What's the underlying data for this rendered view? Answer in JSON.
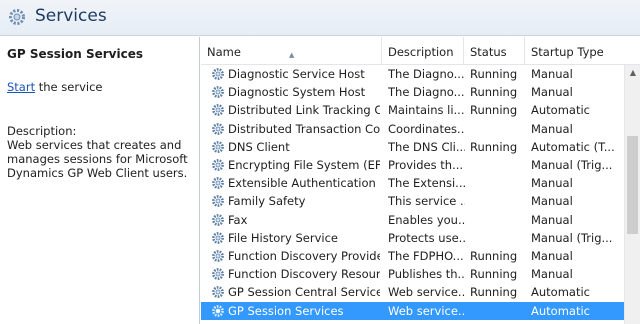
{
  "window": {
    "title": "Services",
    "icon": "services-gear-icon"
  },
  "left_pane": {
    "title": "GP Session Services",
    "action_link": "Start",
    "action_rest": " the service",
    "description_label": "Description:",
    "description_text": "Web services that creates and manages sessions for Microsoft Dynamics GP Web Client users."
  },
  "table": {
    "columns": [
      "Name",
      "Description",
      "Status",
      "Startup Type"
    ],
    "sorted_column": "Name",
    "rows": [
      {
        "name": "Diagnostic Service Host",
        "description": "The Diagno...",
        "status": "Running",
        "startup": "Manual",
        "selected": false
      },
      {
        "name": "Diagnostic System Host",
        "description": "The Diagno...",
        "status": "Running",
        "startup": "Manual",
        "selected": false
      },
      {
        "name": "Distributed Link Tracking Cl...",
        "description": "Maintains li...",
        "status": "Running",
        "startup": "Automatic",
        "selected": false
      },
      {
        "name": "Distributed Transaction Co...",
        "description": "Coordinates...",
        "status": "",
        "startup": "Manual",
        "selected": false
      },
      {
        "name": "DNS Client",
        "description": "The DNS Cli...",
        "status": "Running",
        "startup": "Automatic (T...",
        "selected": false
      },
      {
        "name": "Encrypting File System (EFS)",
        "description": "Provides th...",
        "status": "",
        "startup": "Manual (Trig...",
        "selected": false
      },
      {
        "name": "Extensible Authentication P...",
        "description": "The Extensi...",
        "status": "",
        "startup": "Manual",
        "selected": false
      },
      {
        "name": "Family Safety",
        "description": "This service ...",
        "status": "",
        "startup": "Manual",
        "selected": false
      },
      {
        "name": "Fax",
        "description": "Enables you...",
        "status": "",
        "startup": "Manual",
        "selected": false
      },
      {
        "name": "File History Service",
        "description": "Protects use...",
        "status": "",
        "startup": "Manual (Trig...",
        "selected": false
      },
      {
        "name": "Function Discovery Provide...",
        "description": "The FDPHO...",
        "status": "Running",
        "startup": "Manual",
        "selected": false
      },
      {
        "name": "Function Discovery Resourc...",
        "description": "Publishes th...",
        "status": "Running",
        "startup": "Manual",
        "selected": false
      },
      {
        "name": "GP Session Central Service",
        "description": "Web service...",
        "status": "Running",
        "startup": "Automatic",
        "selected": false
      },
      {
        "name": "GP Session Services",
        "description": "Web service...",
        "status": "",
        "startup": "Automatic",
        "selected": true
      }
    ]
  },
  "colors": {
    "selection": "#3399ff",
    "link": "#1a56b8",
    "title": "#1e3b63",
    "gear": "#5b7fa6"
  }
}
